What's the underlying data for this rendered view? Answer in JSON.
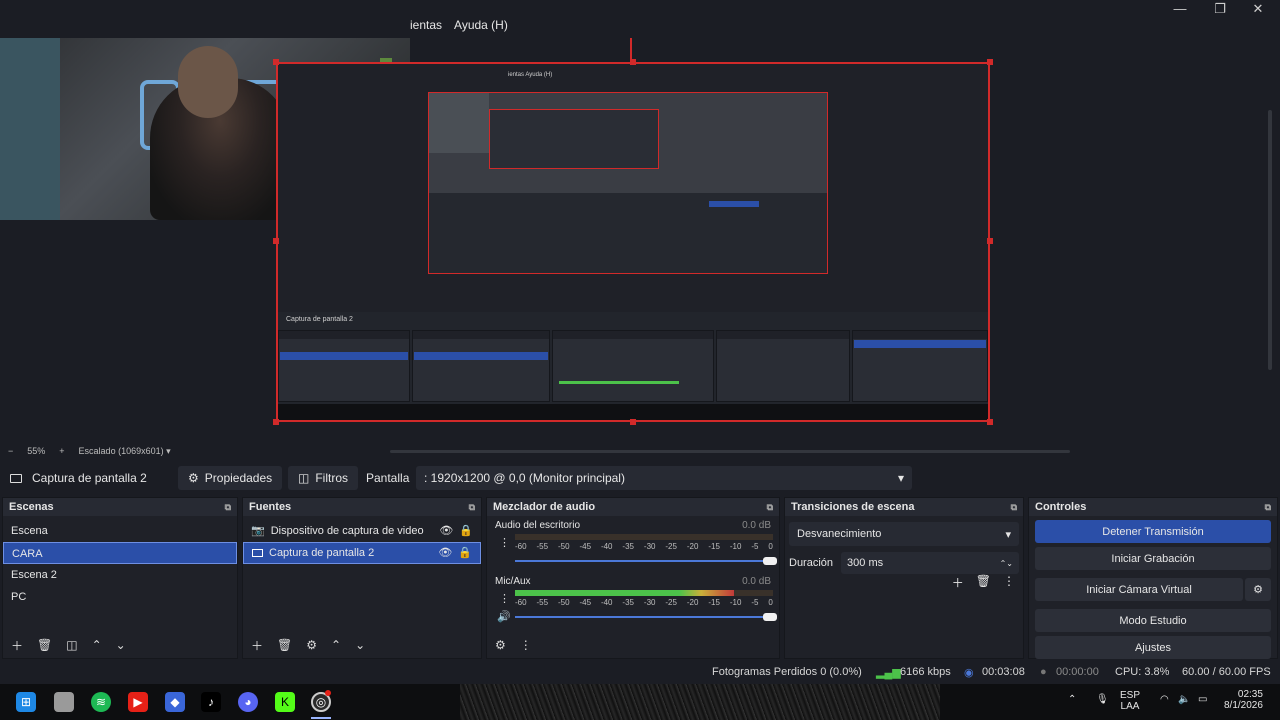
{
  "menu": {
    "items": [
      "ientas",
      "Ayuda (H)"
    ]
  },
  "window_controls": {
    "minimize": "—",
    "maximize": "❐",
    "close": "✕"
  },
  "preview": {
    "zoom_minus": "−",
    "zoom_level": "55%",
    "zoom_plus": "+",
    "scaling": "Escalado (1069x601)",
    "nested_menu": "ientas   Ayuda (H)"
  },
  "source_toolbar": {
    "source_name": "Captura de pantalla 2",
    "properties_label": "Propiedades",
    "filters_label": "Filtros",
    "display_label": "Pantalla",
    "display_value": ": 1920x1200 @ 0,0 (Monitor principal)"
  },
  "scenes": {
    "title": "Escenas",
    "items": [
      "Escena",
      "CARA",
      "Escena 2",
      "PC"
    ],
    "selected_index": 1
  },
  "sources": {
    "title": "Fuentes",
    "items": [
      "Dispositivo de captura de video",
      "Captura de pantalla 2"
    ],
    "selected_index": 1
  },
  "mixer": {
    "title": "Mezclador de audio",
    "channels": [
      {
        "name": "Audio del escritorio",
        "db": "0.0 dB",
        "level": 0.0
      },
      {
        "name": "Mic/Aux",
        "db": "0.0 dB",
        "level": 0.85
      }
    ],
    "scale": [
      "-60",
      "-55",
      "-50",
      "-45",
      "-40",
      "-35",
      "-30",
      "-25",
      "-20",
      "-15",
      "-10",
      "-5",
      "0"
    ]
  },
  "transitions": {
    "title": "Transiciones de escena",
    "type": "Desvanecimiento",
    "duration_label": "Duración",
    "duration_value": "300 ms"
  },
  "controls": {
    "title": "Controles",
    "stop_stream": "Detener Transmisión",
    "start_recording": "Iniciar Grabación",
    "start_virtual_cam": "Iniciar Cámara Virtual",
    "studio_mode": "Modo Estudio",
    "settings": "Ajustes"
  },
  "status": {
    "dropped_frames": "Fotogramas Perdidos 0 (0.0%)",
    "bitrate": "6166 kbps",
    "stream_time": "00:03:08",
    "rec_time": "00:00:00",
    "cpu": "CPU: 3.8%",
    "fps": "60.00 / 60.00 FPS"
  },
  "taskbar": {
    "lang_top": "ESP",
    "lang_bottom": "LAA",
    "time": "02:35",
    "date": "8/1/2026"
  },
  "colors": {
    "accent": "#2b4fa8",
    "selection_border": "#d12a2a",
    "meter_green": "#4cc24a",
    "meter_yellow": "#c9b03a",
    "meter_red": "#c23a3a"
  }
}
